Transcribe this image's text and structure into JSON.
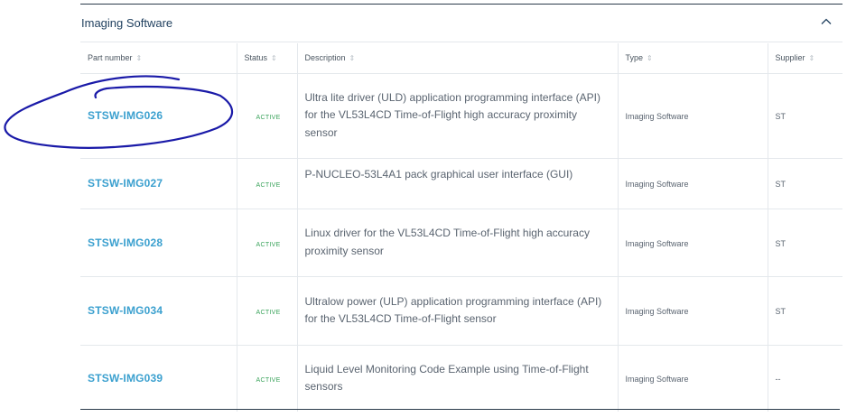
{
  "section": {
    "title": "Imaging Software"
  },
  "columns": [
    {
      "label": "Part number"
    },
    {
      "label": "Status"
    },
    {
      "label": "Description"
    },
    {
      "label": "Type"
    },
    {
      "label": "Supplier"
    }
  ],
  "rows": [
    {
      "part": "STSW-IMG026",
      "status": "ACTIVE",
      "description": "Ultra lite driver (ULD) application programming interface (API) for the VL53L4CD Time-of-Flight high accuracy proximity sensor",
      "type": "Imaging Software",
      "supplier": "ST"
    },
    {
      "part": "STSW-IMG027",
      "status": "ACTIVE",
      "description": "P-NUCLEO-53L4A1 pack graphical user interface (GUI)",
      "type": "Imaging Software",
      "supplier": "ST"
    },
    {
      "part": "STSW-IMG028",
      "status": "ACTIVE",
      "description": "Linux driver for the VL53L4CD Time-of-Flight high accuracy proximity sensor",
      "type": "Imaging Software",
      "supplier": "ST"
    },
    {
      "part": "STSW-IMG034",
      "status": "ACTIVE",
      "description": "Ultralow power (ULP) application programming interface (API) for the VL53L4CD Time-of-Flight sensor",
      "type": "Imaging Software",
      "supplier": "ST"
    },
    {
      "part": "STSW-IMG039",
      "status": "ACTIVE",
      "description": "Liquid Level Monitoring Code Example using Time-of-Flight sensors",
      "type": "Imaging Software",
      "supplier": "--"
    }
  ],
  "colors": {
    "link": "#3ba0cf",
    "status_active": "#3aa35b",
    "header_title": "#1f3f5e",
    "annotation": "#1a1aa8"
  }
}
